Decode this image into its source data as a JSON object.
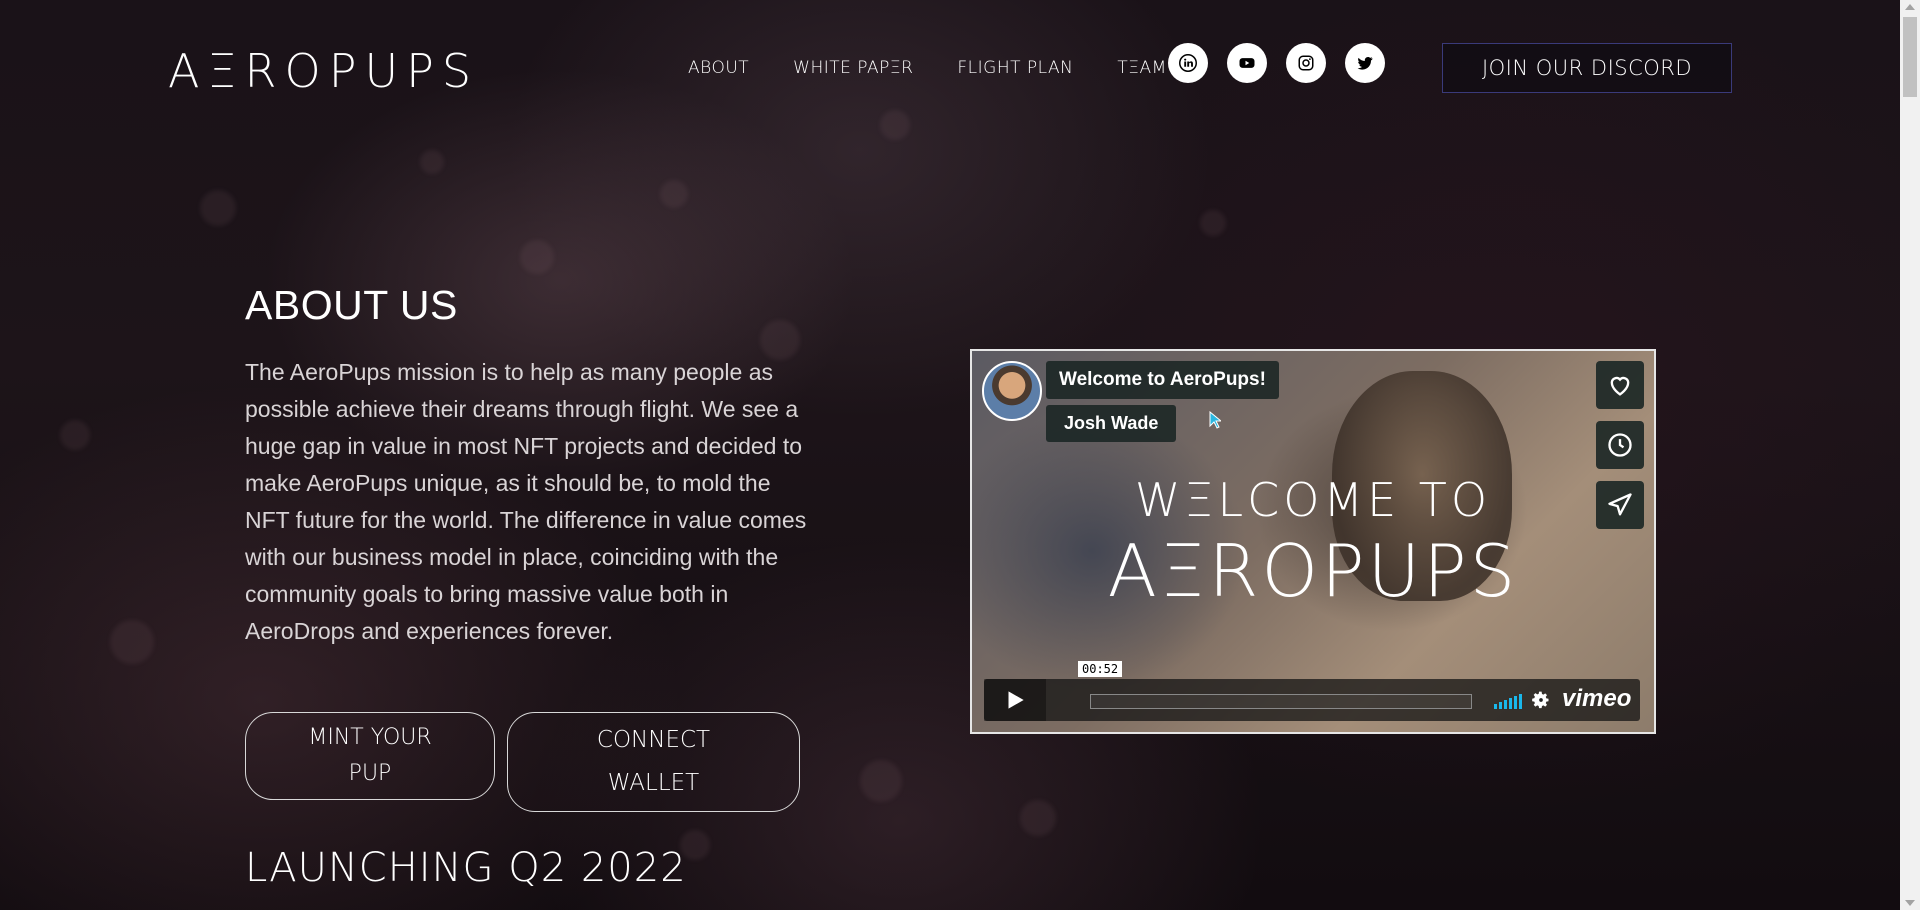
{
  "brand": {
    "logo": "AΞROPUPS"
  },
  "nav": {
    "items": [
      {
        "label": "ABOUT"
      },
      {
        "label": "WHITE PAPΞR"
      },
      {
        "label": "FLIGHT PLAN"
      },
      {
        "label": "TΞAM"
      }
    ],
    "socials": [
      {
        "icon": "linkedin-icon"
      },
      {
        "icon": "youtube-icon"
      },
      {
        "icon": "instagram-icon"
      },
      {
        "icon": "twitter-icon"
      }
    ],
    "discord_label": "JOIN OUR DISCORD"
  },
  "about": {
    "title": "ABOUT US",
    "body": "The AeroPups mission is to help as many people as possible achieve their dreams through flight. We see a huge gap in value in most NFT projects and decided to make AeroPups unique, as it should be, to mold the NFT future for the world. The difference in value comes with our business model in place, coinciding with the community goals to bring massive value both in AeroDrops and experiences forever.",
    "mint_line1": "MINT YOUR",
    "mint_line2": "PUP",
    "connect_line1": "CONNECT",
    "connect_line2": "WALLET",
    "launch": "LAUNCHING Q2 2022"
  },
  "video": {
    "title": "Welcome to AeroPups!",
    "author": "Josh Wade",
    "overlay_line1": "WΞLCOME TO",
    "overlay_line2": "AΞROPUPS",
    "time": "00:52",
    "provider": "vimeo",
    "accent": "#1ab7ea"
  },
  "colors": {
    "background": "#1a1218",
    "text": "#ffffff",
    "body_text": "#d9d4d6",
    "discord_border": "#3a3a7a"
  }
}
